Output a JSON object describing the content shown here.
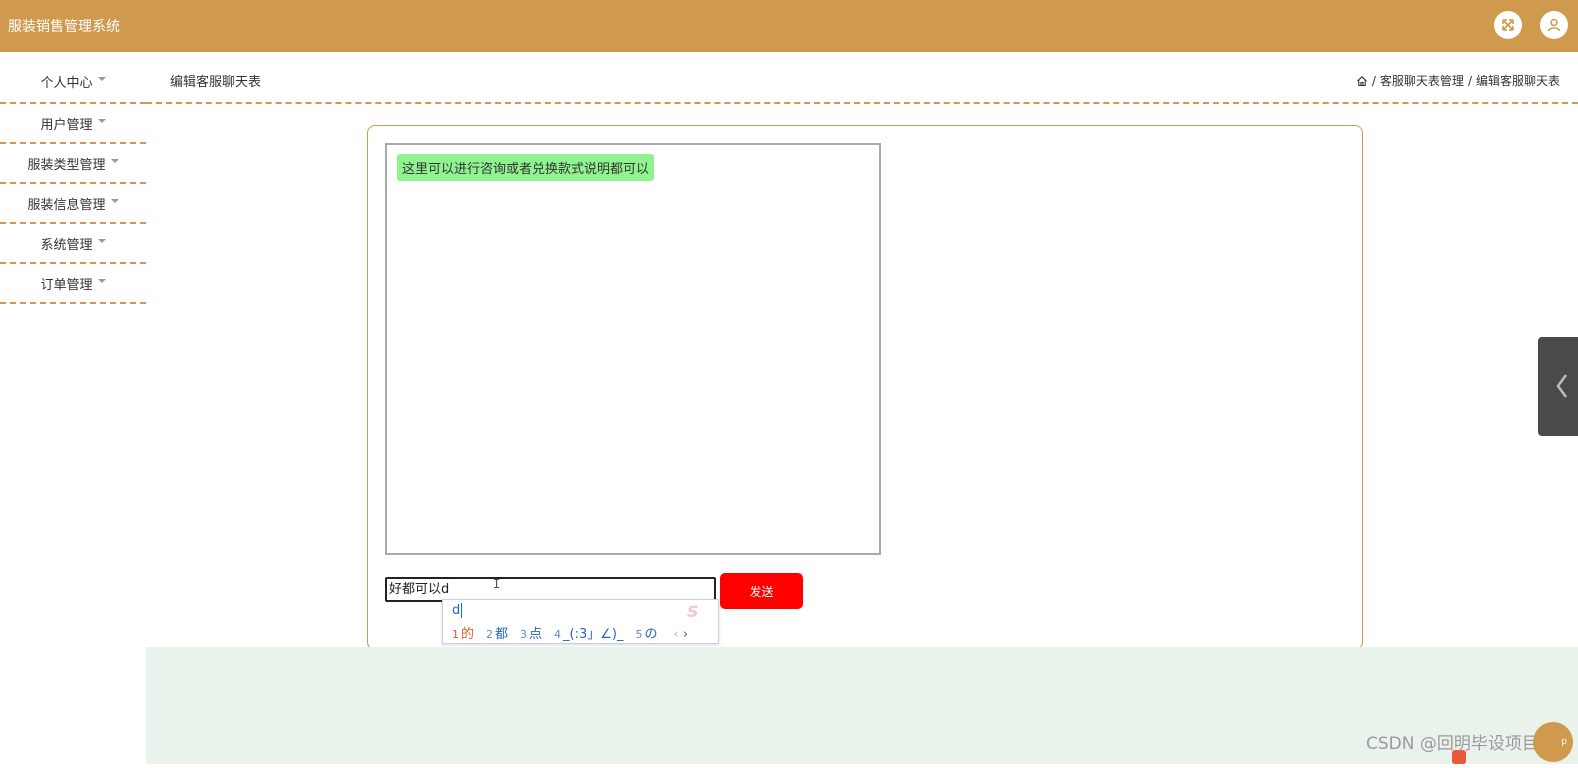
{
  "app": {
    "title": "服装销售管理系统"
  },
  "topbar": {
    "icons": [
      "fullscreen-icon",
      "user-icon"
    ],
    "accent_color": "#cf994e"
  },
  "sidebar": {
    "items": [
      {
        "label": "个人中心"
      },
      {
        "label": "用户管理"
      },
      {
        "label": "服装类型管理"
      },
      {
        "label": "服装信息管理"
      },
      {
        "label": "系统管理"
      },
      {
        "label": "订单管理"
      }
    ]
  },
  "header": {
    "page_title": "编辑客服聊天表",
    "breadcrumb": [
      "客服聊天表管理",
      "编辑客服聊天表"
    ],
    "separator": "/"
  },
  "chat": {
    "messages": [
      {
        "text": "这里可以进行咨询或者兑换款式说明都可以",
        "color": "#8ff48f"
      }
    ],
    "input_value": "好都可以d",
    "send_label": "发送",
    "send_color": "#ff0000"
  },
  "ime": {
    "composition": "d",
    "candidates": [
      {
        "num": "1",
        "word": "的"
      },
      {
        "num": "2",
        "word": "都"
      },
      {
        "num": "3",
        "word": "点"
      },
      {
        "num": "4",
        "word": "_(:3」∠)_"
      },
      {
        "num": "5",
        "word": "の"
      }
    ],
    "prev": "‹",
    "next": "›"
  },
  "watermark": {
    "text": "CSDN @回明毕设项目"
  },
  "help_badge": {
    "text": "p"
  }
}
